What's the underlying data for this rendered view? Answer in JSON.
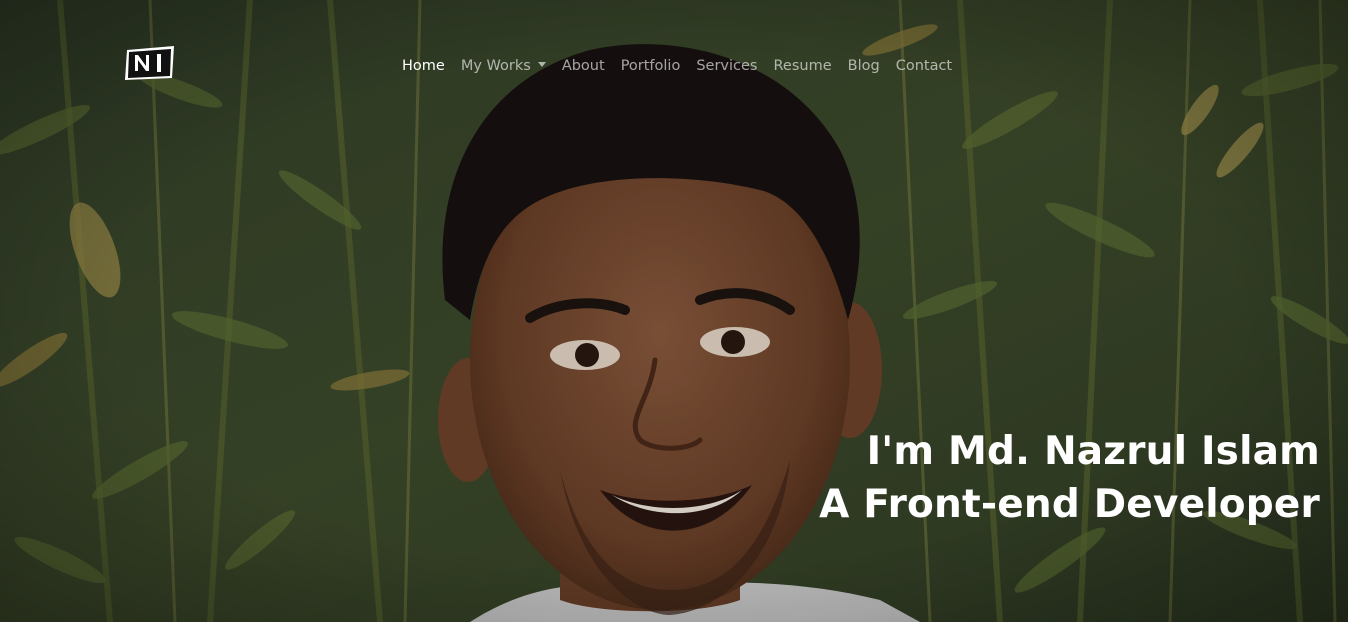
{
  "brand": {
    "logo_text": "N I",
    "logo_icon": "ni-logo-badge"
  },
  "nav": {
    "items": [
      {
        "label": "Home",
        "active": true
      },
      {
        "label": "My Works",
        "active": false,
        "dropdown": true
      },
      {
        "label": "About",
        "active": false
      },
      {
        "label": "Portfolio",
        "active": false
      },
      {
        "label": "Services",
        "active": false
      },
      {
        "label": "Resume",
        "active": false
      },
      {
        "label": "Blog",
        "active": false
      },
      {
        "label": "Contact",
        "active": false
      }
    ]
  },
  "hero": {
    "line1": "I'm Md. Nazrul Islam",
    "line2": "A Front-end Developer",
    "background": "portrait-photo-bamboo-foliage"
  },
  "colors": {
    "nav_active": "#ffffff",
    "nav_inactive": "#c8c8c8",
    "hero_text": "#ffffff",
    "foliage_dark": "#2c3a22",
    "foliage_light": "#6b7a3e"
  }
}
